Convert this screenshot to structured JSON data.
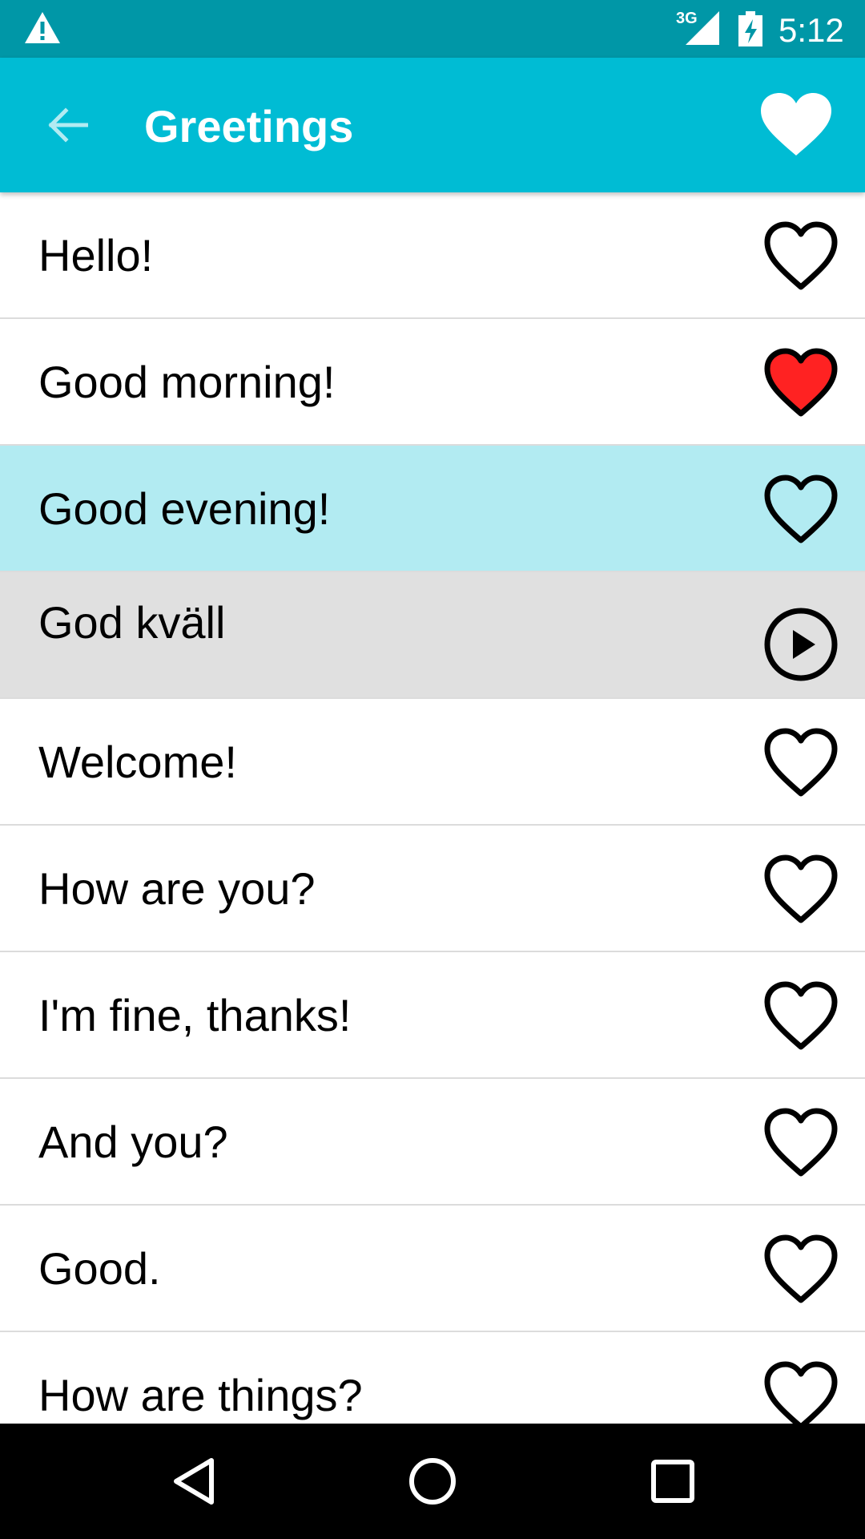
{
  "status_bar": {
    "network": "3G",
    "time": "5:12",
    "icons": [
      "warning-icon",
      "signal-icon",
      "battery-charging-icon"
    ]
  },
  "app_bar": {
    "title": "Greetings",
    "back_icon": "arrow-back-icon",
    "favorite_icon": "heart-filled-icon"
  },
  "colors": {
    "status_bar": "#0097a7",
    "app_bar": "#00bcd4",
    "selected_row": "#b2ebf2",
    "sub_row": "#e0e0e0",
    "favorite": "#ff2222"
  },
  "list": {
    "items": [
      {
        "label": "Hello!",
        "icon": "heart-outline-icon",
        "favorite": false
      },
      {
        "label": "Good morning!",
        "icon": "heart-filled-icon",
        "favorite": true
      },
      {
        "label": "Good evening!",
        "icon": "heart-outline-icon",
        "favorite": false,
        "selected": true
      },
      {
        "label": "God kväll",
        "icon": "play-circle-icon",
        "translation": true
      },
      {
        "label": "Welcome!",
        "icon": "heart-outline-icon",
        "favorite": false
      },
      {
        "label": "How are you?",
        "icon": "heart-outline-icon",
        "favorite": false
      },
      {
        "label": "I'm fine, thanks!",
        "icon": "heart-outline-icon",
        "favorite": false
      },
      {
        "label": "And you?",
        "icon": "heart-outline-icon",
        "favorite": false
      },
      {
        "label": "Good.",
        "icon": "heart-outline-icon",
        "favorite": false
      },
      {
        "label": "How are things?",
        "icon": "heart-outline-icon",
        "favorite": false
      }
    ]
  },
  "nav_bar": {
    "icons": [
      "nav-back-icon",
      "nav-home-icon",
      "nav-recents-icon"
    ]
  }
}
